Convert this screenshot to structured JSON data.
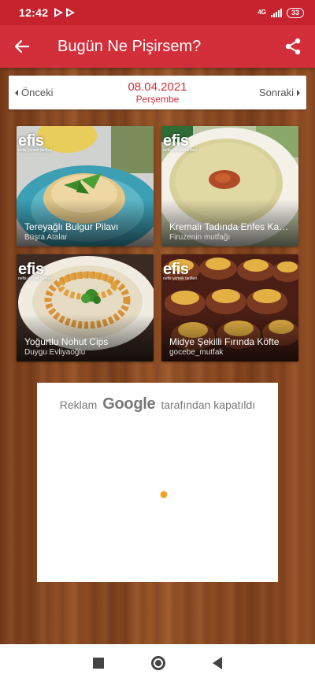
{
  "status_bar": {
    "time": "12:42",
    "network": "4G",
    "battery": "33"
  },
  "app_bar": {
    "title": "Bugün Ne Pişirsem?",
    "back_icon": "arrow-left-icon",
    "share_icon": "share-icon"
  },
  "date_nav": {
    "prev_label": "Önceki",
    "next_label": "Sonraki",
    "date": "08.04.2021",
    "day": "Perşembe"
  },
  "logo": {
    "main": "efis",
    "sub": "nefis yemek tarifleri"
  },
  "recipes": [
    {
      "title": "Tereyağlı Bulgur Pilavı",
      "author": "Büşra Atalar"
    },
    {
      "title": "Kremalı Tadında Enfes Kabak Çorbası",
      "author": "Firuzenin mutfağı"
    },
    {
      "title": "Yoğurtlu Nohut Cips",
      "author": "Duygu Evliyaoğlu"
    },
    {
      "title": "Midye Şekilli Fırında Köfte",
      "author": "gocebe_mutfak"
    }
  ],
  "ad": {
    "prefix": "Reklam",
    "brand": "Google",
    "suffix": "tarafından kapatıldı"
  },
  "colors": {
    "primary": "#d32f3a",
    "status_bar": "#c7232f"
  }
}
